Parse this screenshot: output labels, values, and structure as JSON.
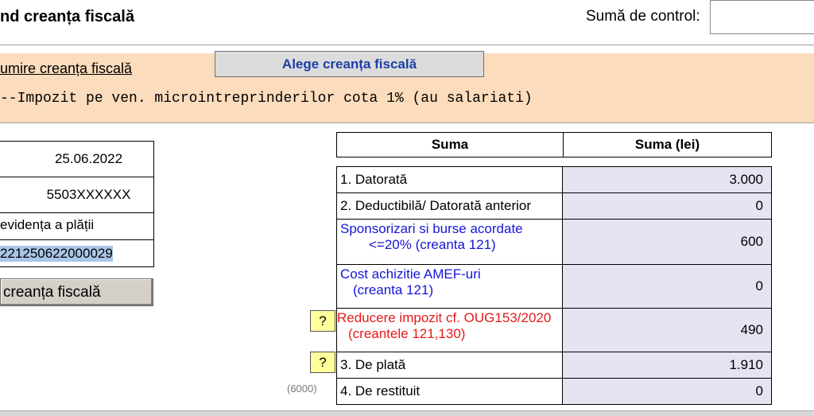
{
  "header": {
    "title": "nd creanța fiscală",
    "control_label": "Sumă de control:",
    "control_value": ""
  },
  "fiscal_claim": {
    "denumire_label": "umire creanța fiscală",
    "choose_button": "Alege creanța fiscală",
    "selected_text": "--Impozit pe ven. microintreprinderilor cota 1% (au salariati)"
  },
  "left_panel": {
    "date": "25.06.2022",
    "code": "5503XXXXXX",
    "evidence_label": "evidența a plății",
    "evidence_value": "221250622000029",
    "button_label": "creanța fiscală"
  },
  "sums_table": {
    "col1_header": "Suma",
    "col2_header": "Suma (lei)",
    "rows": [
      {
        "label": "1. Datorată",
        "value": "3.000"
      },
      {
        "label": "2. Deductibilă/ Datorată anterior",
        "value": "0"
      },
      {
        "label_line1": "Sponsorizari si burse acordate",
        "label_line2": "<=20% (creanta 121)",
        "value": "600"
      },
      {
        "label_line1": "Cost achizitie AMEF-uri",
        "label_line2": "(creanta 121)",
        "value": "0"
      },
      {
        "label_line1": "Reducere impozit cf. OUG153/2020",
        "label_line2": "(creantele 121,130)",
        "value": "490"
      },
      {
        "label": "3. De plată",
        "value": "1.910"
      },
      {
        "label": "4. De restituit",
        "value": "0"
      }
    ],
    "help_glyph": "?",
    "restituit_code": "(6000)"
  },
  "colors": {
    "peach_band": "#fbdcbc",
    "value_bg": "#e4e4f2",
    "blue_text": "#1616d8",
    "red_text": "#e81818",
    "help_bg": "#ffff9c"
  }
}
